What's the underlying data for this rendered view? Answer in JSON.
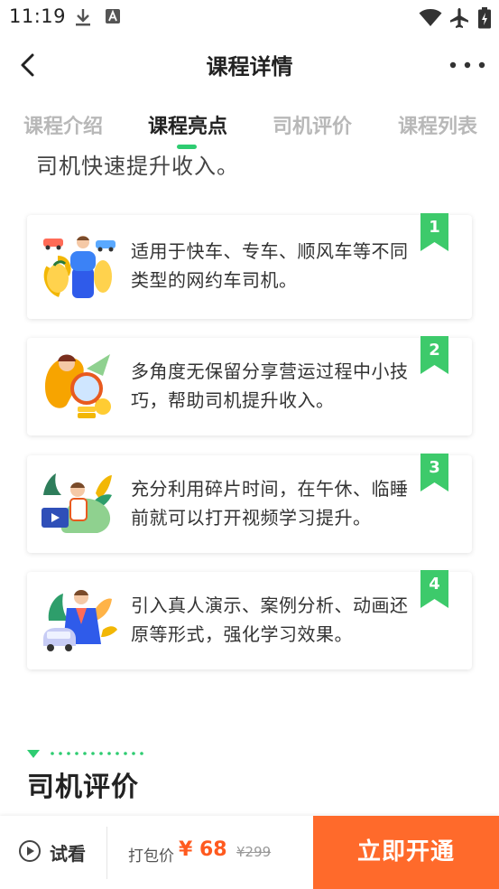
{
  "status_bar": {
    "time": "11:19",
    "icons": [
      "download-icon",
      "font-a-icon",
      "wifi-icon",
      "airplane-icon",
      "battery-charging-icon"
    ]
  },
  "header": {
    "title": "课程详情",
    "back_icon": "chevron-left-icon",
    "more_icon": "more-dots-icon"
  },
  "tabs": [
    {
      "label": "课程介绍",
      "active": false
    },
    {
      "label": "课程亮点",
      "active": true
    },
    {
      "label": "司机评价",
      "active": false
    },
    {
      "label": "课程列表",
      "active": false
    }
  ],
  "intro_tail": "司机快速提升收入。",
  "highlights": [
    {
      "number": "1",
      "text": "适用于快车、专车、顺风车等不同类型的网约车司机。",
      "illustration": "cars-and-driver-illustration"
    },
    {
      "number": "2",
      "text": "多角度无保留分享营运过程中小技巧，帮助司机提升收入。",
      "illustration": "magnifier-coins-illustration"
    },
    {
      "number": "3",
      "text": "充分利用碎片时间，在午休、临睡前就可以打开视频学习提升。",
      "illustration": "video-learning-illustration"
    },
    {
      "number": "4",
      "text": "引入真人演示、案例分析、动画还原等形式，强化学习效果。",
      "illustration": "car-demo-illustration"
    }
  ],
  "next_section_title": "司机评价",
  "bottom_bar": {
    "preview_label": "试看",
    "bundle_label": "打包价",
    "price": "¥ 68",
    "original_price": "¥299",
    "buy_label": "立即开通"
  },
  "colors": {
    "accent_green": "#2ecc71",
    "ribbon_green": "#3dca6b",
    "price_orange": "#ff5a1f",
    "buy_button": "#ff6a2b"
  }
}
